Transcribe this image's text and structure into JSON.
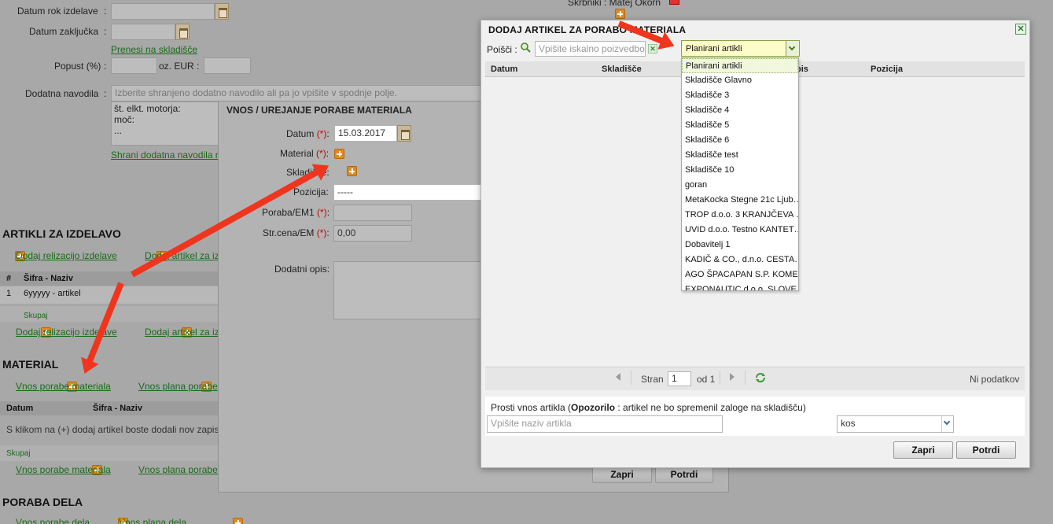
{
  "bg": {
    "datum_rok": "Datum rok izdelave",
    "datum_zakljucka": "Datum zaključka",
    "prenesi": "Prenesi na skladišče",
    "popust": "Popust (%)",
    "oz_eur": "oz. EUR",
    "dodatna_navodila": "Dodatna navodila",
    "navodila_placeholder": "Izberite shranjeno dodatno navodilo ali pa jo vpišite v spodnje polje.",
    "navodila_text": [
      "št. elkt. motorja:",
      "moč:",
      "..."
    ],
    "shrani_navodila": "Shrani dodatna navodila n",
    "skrbniki": "Skrbniki : Matej Okorn",
    "artikli_heading": "ARTIKLI ZA IZDELAVO",
    "dodaj_relizacijo": "Dodaj relizacijo izdelave",
    "dodaj_artikel": "Dodaj artikel za iz",
    "col_num": "#",
    "col_sifra": "Šifra - Naziv",
    "row1_num": "1",
    "row1_name": "6yyyyy - artikel",
    "skupaj": "Skupaj",
    "material_heading": "MATERIAL",
    "vnos_porabe": "Vnos porabe materiala",
    "vnos_plana": "Vnos plana porabe",
    "vnos_plana_full": "Vnos plana porabe materiala",
    "col_datum": "Datum",
    "empty_msg": "S klikom na (+) dodaj artikel boste dodali nov zapis.",
    "poraba_dela_heading": "PORABA DELA",
    "vnos_porabe_dela": "Vnos porabe dela",
    "vnos_plana_dela": "Vnos plana dela"
  },
  "mid": {
    "title": "VNOS / UREJANJE PORABE MATERIALA",
    "datum_label": "Datum",
    "datum_value": "15.03.2017",
    "material_label": "Material",
    "skladisce_label": "Skladišče",
    "pozicija_label": "Pozicija:",
    "pozicija_value": "-----",
    "poraba_label": "Poraba/EM1",
    "strcena_label": "Str.cena/EM",
    "strcena_value": "0,00",
    "dodatni_opis": "Dodatni opis:",
    "req": "(*)",
    "zapri": "Zapri",
    "potrdi": "Potrdi"
  },
  "dlg": {
    "title": "DODAJ ARTIKEL ZA PORABO MATERIALA",
    "close": "✕",
    "isci_label": "Poišči :",
    "search_placeholder": "Vpišite iskalno poizvedbo",
    "combo_value": "Planirani artikli",
    "col_datum": "Datum",
    "col_skladisce": "Skladišče",
    "col_opis": "pis",
    "col_pozicija": "Pozicija",
    "options": [
      "Planirani artikli",
      "Skladišče Glavno",
      "Skladišče 3",
      "Skladišče 4",
      "Skladišče 5",
      "Skladišče 6",
      "Skladišče test",
      "Skladišče 10",
      "goran",
      "MetaKocka Stegne 21c Ljub…",
      "TROP d.o.o. 3 KRANJČEVA …",
      "UVID d.o.o. Testno KANTET…",
      "Dobavitelj 1",
      "KADIČ & CO., d.n.o. CESTA…",
      "AGO ŠPACAPAN S.P. KOME…",
      "EXPONAUTIC d.o.o. SLOVE…"
    ],
    "stran": "Stran",
    "page": "1",
    "od": "od 1",
    "ni_podatkov": "Ni podatkov",
    "prosti_prefix": "Prosti vnos artikla (",
    "opozorilo": "Opozorilo",
    "prosti_suffix": " : artikel ne bo spremenil zaloge na skladišču)",
    "naziv_placeholder": "Vpišite naziv artikla",
    "unit_value": "kos",
    "zapri": "Zapri",
    "potrdi": "Potrdi"
  }
}
